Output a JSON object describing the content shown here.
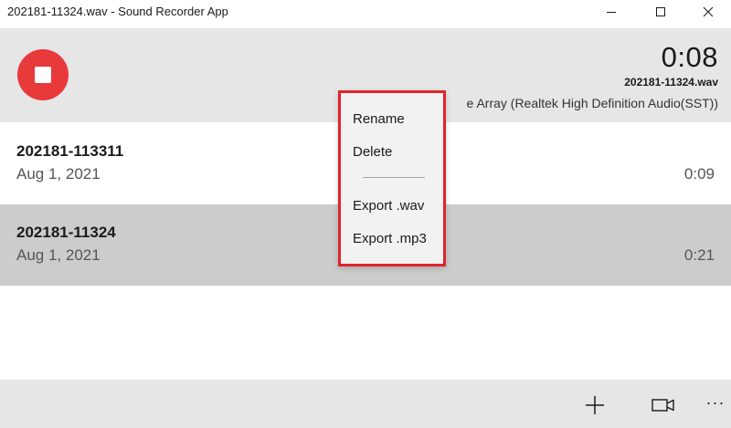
{
  "window": {
    "title": "202181-11324.wav - Sound Recorder App",
    "controls": [
      "minimize-icon",
      "maximize-icon",
      "close-icon"
    ]
  },
  "recording": {
    "timer": "0:08",
    "filename": "202181-11324.wav",
    "device": "e Array (Realtek High Definition Audio(SST))",
    "stop_button_icon": "stop-icon",
    "accent_color": "#e8393b"
  },
  "recordings": [
    {
      "name": "202181-113311",
      "date": "Aug 1, 2021",
      "duration": "0:09",
      "selected": false
    },
    {
      "name": "202181-11324",
      "date": "Aug 1, 2021",
      "duration": "0:21",
      "selected": true
    }
  ],
  "context_menu": {
    "highlight_color": "#e0242b",
    "items": [
      {
        "label": "Rename"
      },
      {
        "label": "Delete"
      },
      {
        "label": "Export .wav"
      },
      {
        "label": "Export .mp3"
      }
    ]
  },
  "command_bar": {
    "icons": [
      "plus-icon",
      "video-camera-icon",
      "more-icon"
    ],
    "more_label": "···"
  }
}
